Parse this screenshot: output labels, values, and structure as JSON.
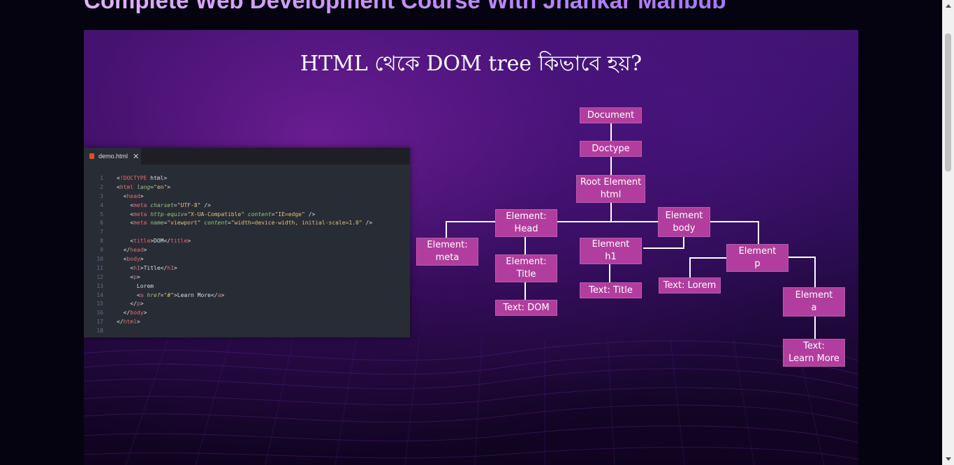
{
  "page": {
    "heading": "Complete Web Development Course With Jhankar Mahbub"
  },
  "slide": {
    "title": "HTML থেকে DOM tree কিভাবে হয়?",
    "editor": {
      "tab_filename": "demo.html",
      "close_icon": "close-icon",
      "file_icon": "html-file-icon",
      "line_numbers": [
        "1",
        "2",
        "3",
        "4",
        "5",
        "6",
        "7",
        "8",
        "9",
        "10",
        "11",
        "12",
        "13",
        "14",
        "15",
        "16",
        "17",
        "18"
      ],
      "lines": [
        "<!DOCTYPE html>",
        "<html lang=\"en\">",
        "  <head>",
        "    <meta charset=\"UTF-8\" />",
        "    <meta http-equiv=\"X-UA-Compatible\" content=\"IE=edge\" />",
        "    <meta name=\"viewport\" content=\"width=device-width, initial-scale=1.0\" />",
        "",
        "    <title>DOM</title>",
        "  </head>",
        "  <body>",
        "    <h1>Title</h1>",
        "    <p>",
        "      Lorem",
        "      <a href=\"#\">Learn More</a>",
        "    </p>",
        "  </body>",
        "</html>",
        ""
      ]
    },
    "tree": {
      "document": "Document",
      "doctype": "Doctype",
      "root_l1": "Root Element",
      "root_l2": "html",
      "head_l1": "Element:",
      "head_l2": "Head",
      "body_l1": "Element",
      "body_l2": "body",
      "meta_l1": "Element:",
      "meta_l2": "meta",
      "title_l1": "Element:",
      "title_l2": "Title",
      "text_dom": "Text: DOM",
      "h1_l1": "Element",
      "h1_l2": "h1",
      "text_title": "Text: Title",
      "p_l1": "Element",
      "p_l2": "p",
      "text_lorem": "Text: Lorem",
      "a_l1": "Element",
      "a_l2": "a",
      "text_learn_l1": "Text:",
      "text_learn_l2": "Learn More"
    }
  },
  "colors": {
    "heading_gradient": [
      "#e3b2ff",
      "#a877ff"
    ],
    "tree_node": "#b13e9e",
    "editor_bg": "#282c34",
    "page_bg": "#04030f"
  },
  "scrollbar": {
    "up_icon": "arrow-up-icon",
    "down_icon": "arrow-down-icon"
  }
}
